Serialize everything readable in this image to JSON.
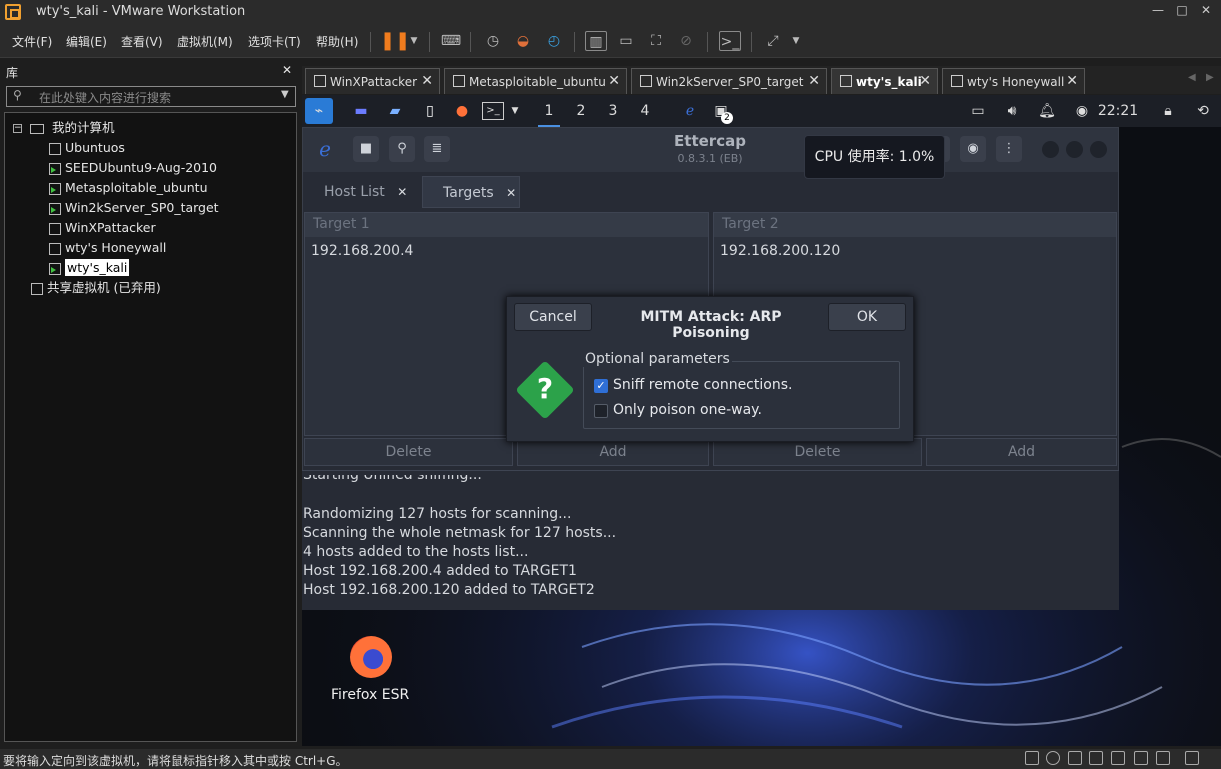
{
  "window": {
    "title": "wty's_kali - VMware Workstation",
    "minimize": "—",
    "maximize": "□",
    "close": "✕"
  },
  "menu": [
    "文件(F)",
    "编辑(E)",
    "查看(V)",
    "虚拟机(M)",
    "选项卡(T)",
    "帮助(H)"
  ],
  "library": {
    "title": "库",
    "close": "✕",
    "search_placeholder": "在此处键入内容进行搜索",
    "root": "我的计算机",
    "items": [
      "Ubuntuos",
      "SEEDUbuntu9-Aug-2010",
      "Metasploitable_ubuntu",
      "Win2kServer_SP0_target",
      "WinXPattacker",
      "wty's Honeywall",
      "wty's_kali"
    ],
    "shared": "共享虚拟机 (已弃用)"
  },
  "tabs": [
    {
      "label": "WinXPattacker"
    },
    {
      "label": "Metasploitable_ubuntu"
    },
    {
      "label": "Win2kServer_SP0_target"
    },
    {
      "label": "wty's_kali"
    },
    {
      "label": "wty's Honeywall"
    }
  ],
  "tab_close": "✕",
  "kali_panel": {
    "workspaces": [
      "1",
      "2",
      "3",
      "4"
    ],
    "terminal_badge": "2",
    "clock": "22:21"
  },
  "ettercap": {
    "title": "Ettercap",
    "version": "0.8.3.1 (EB)",
    "subtabs": [
      "Host List",
      "Targets"
    ],
    "tab_close": "✕",
    "target1": {
      "header": "Target 1",
      "ip": "192.168.200.4"
    },
    "target2": {
      "header": "Target 2",
      "ip": "192.168.200.120"
    },
    "buttons": {
      "delete": "Delete",
      "add": "Add"
    },
    "log_partial": "Starting Unified sniffing...",
    "log": [
      "Randomizing 127 hosts for scanning...",
      "Scanning the whole netmask for 127 hosts...",
      "4 hosts added to the hosts list...",
      "Host 192.168.200.4 added to TARGET1",
      "Host 192.168.200.120 added to TARGET2"
    ]
  },
  "dialog": {
    "cancel": "Cancel",
    "title": "MITM Attack: ARP Poisoning",
    "ok": "OK",
    "section": "Optional parameters",
    "options": [
      {
        "label": "Sniff remote connections.",
        "checked": true
      },
      {
        "label": "Only poison one-way.",
        "checked": false
      }
    ]
  },
  "tooltip": "CPU 使用率: 1.0%",
  "desktop_icon": "Firefox ESR",
  "status": "要将输入定向到该虚拟机，请将鼠标指针移入其中或按 Ctrl+G。"
}
